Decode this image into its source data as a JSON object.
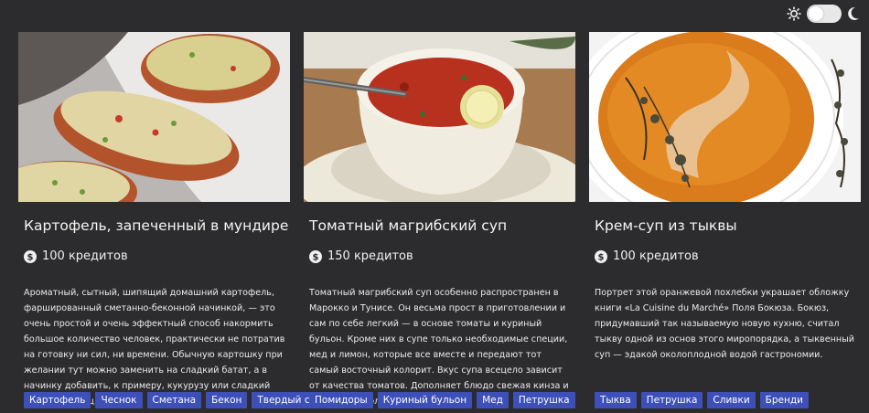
{
  "theme": {
    "background": "#2c2c2e",
    "tag_color": "#3d4fb8",
    "toggle_icons": [
      "sun-icon",
      "moon-icon"
    ]
  },
  "cards": [
    {
      "title": "Картофель, запеченный в мундире",
      "price": "100 кредитов",
      "description": "Ароматный, сытный, шипящий домашний картофель, фаршированный сметанно-беконной начинкой, — это очень простой и очень эффектный способ накормить большое количество человек, практически не потратив на готовку ни сил, ни времени. Обычную картошку при желании тут можно заменить на сладкий батат, а в начинку добавить, к примеру, кукурузу или сладкий красный перец.",
      "tags": [
        "Картофель",
        "Чеснок",
        "Сметана",
        "Бекон",
        "Твердый сыр"
      ]
    },
    {
      "title": "Томатный магрибский суп",
      "price": "150 кредитов",
      "description": "Томатный магрибский суп особенно распространен в Марокко и Тунисе. Он весьма прост в приготовлении и сам по себе легкий — в основе томаты и куриный бульон. Кроме них в супе только необходимые специи, мед и лимон, которые все вместе и передают тот самый восточный колорит. Вкус супа всецело зависит от качества томатов. Дополняет блюдо свежая кинза и отдельные дольки лимона.",
      "tags": [
        "Помидоры",
        "Куриный бульон",
        "Мед",
        "Петрушка"
      ]
    },
    {
      "title": "Крем-суп из тыквы",
      "price": "100 кредитов",
      "description": "Портрет этой оранжевой похлебки украшает обложку книги «La Cuisine du Marché» Поля Бокюза. Бокюз, придумавший так называемую новую кухню, считал тыкву одной из основ этого миропорядка, а тыквенный суп — эдакой околоплодной водой гастрономии.",
      "tags": [
        "Тыква",
        "Петрушка",
        "Сливки",
        "Бренди"
      ]
    }
  ]
}
